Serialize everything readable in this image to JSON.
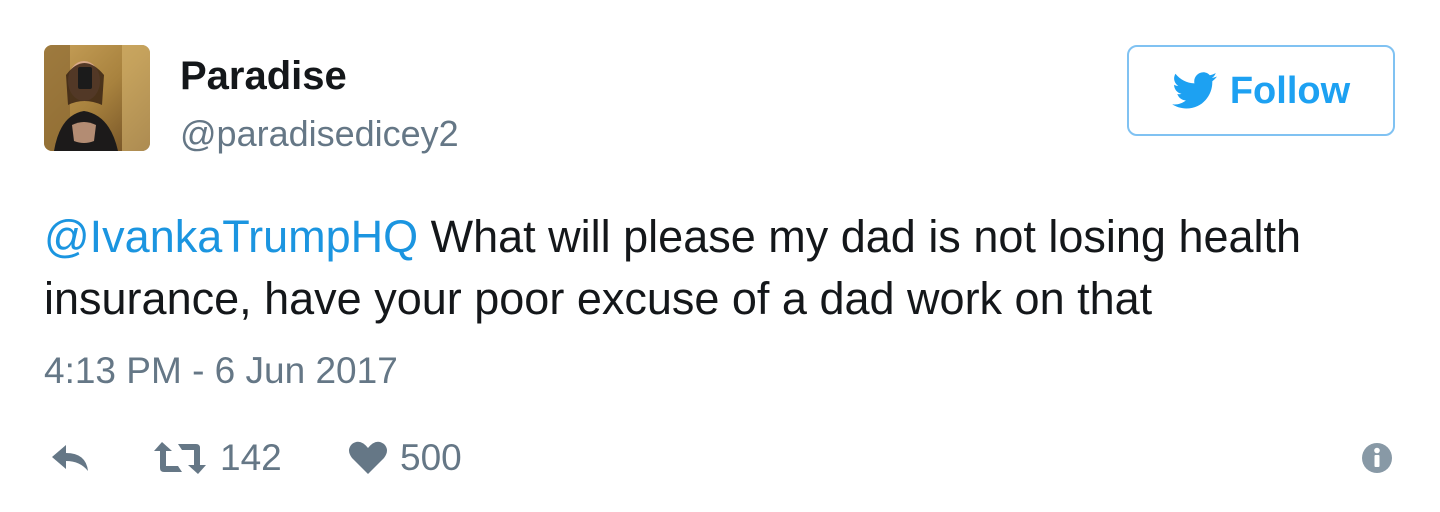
{
  "tweet": {
    "display_name": "Paradise",
    "handle": "@paradisedicey2",
    "follow_label": "Follow",
    "text": {
      "mention": "@IvankaTrumpHQ",
      "body": " What will please my dad is not losing health insurance, have your poor excuse of a dad work on that"
    },
    "timestamp": "4:13 PM - 6 Jun 2017",
    "actions": {
      "reply_icon": "reply-icon",
      "retweet_icon": "retweet-icon",
      "retweet_count": "142",
      "like_icon": "heart-icon",
      "like_count": "500",
      "info_icon": "info-icon"
    }
  },
  "colors": {
    "brand_blue": "#1da1f2",
    "mention_blue": "#1b95e0",
    "follow_border": "#80c2f2",
    "secondary_text": "#657786",
    "primary_text": "#14171a"
  }
}
